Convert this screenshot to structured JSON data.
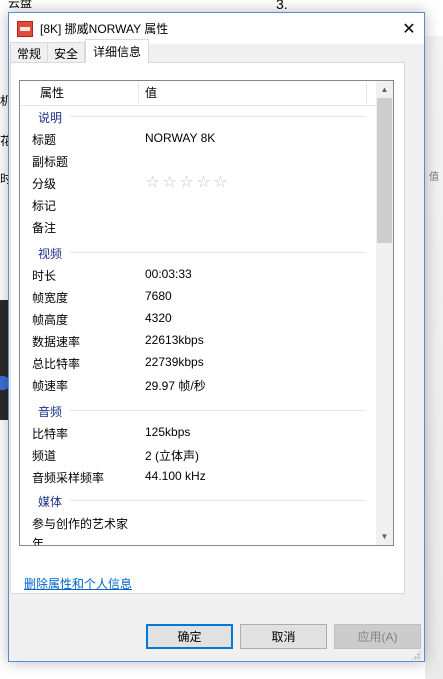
{
  "background": {
    "frag_top_left": "云盘",
    "frag_top_mid": "3.",
    "frag_left_1": "机",
    "frag_left_2": "花",
    "frag_left_3": "时",
    "frag_right": "值"
  },
  "window": {
    "title": "[8K] 挪威NORWAY 属性",
    "close_glyph": "✕",
    "file_icon": "mkv-file-icon"
  },
  "tabs": [
    {
      "label": "常规",
      "active": false
    },
    {
      "label": "安全",
      "active": false
    },
    {
      "label": "详细信息",
      "active": true
    }
  ],
  "list": {
    "columns": {
      "property": "属性",
      "value": "值"
    },
    "groups": {
      "description": {
        "title": "说明",
        "rows": [
          {
            "name": "标题",
            "value": "NORWAY 8K"
          },
          {
            "name": "副标题",
            "value": ""
          },
          {
            "name": "分级",
            "value": ""
          },
          {
            "name": "标记",
            "value": ""
          },
          {
            "name": "备注",
            "value": ""
          }
        ]
      },
      "video": {
        "title": "视频",
        "rows": [
          {
            "name": "时长",
            "value": "00:03:33"
          },
          {
            "name": "帧宽度",
            "value": "7680"
          },
          {
            "name": "帧高度",
            "value": "4320"
          },
          {
            "name": "数据速率",
            "value": "22613kbps"
          },
          {
            "name": "总比特率",
            "value": "22739kbps"
          },
          {
            "name": "帧速率",
            "value": "29.97 帧/秒"
          }
        ]
      },
      "audio": {
        "title": "音频",
        "rows": [
          {
            "name": "比特率",
            "value": "125kbps"
          },
          {
            "name": "频道",
            "value": "2 (立体声)"
          },
          {
            "name": "音频采样频率",
            "value": "44.100 kHz"
          }
        ]
      },
      "media": {
        "title": "媒体",
        "rows": [
          {
            "name": "参与创作的艺术家",
            "value": ""
          },
          {
            "name": "年",
            "value": ""
          }
        ]
      }
    },
    "rating": {
      "stars_filled": 0,
      "stars_total": 5,
      "star_glyph": "☆"
    }
  },
  "remove_link": "删除属性和个人信息",
  "buttons": {
    "ok": "确定",
    "cancel": "取消",
    "apply": "应用(A)"
  }
}
